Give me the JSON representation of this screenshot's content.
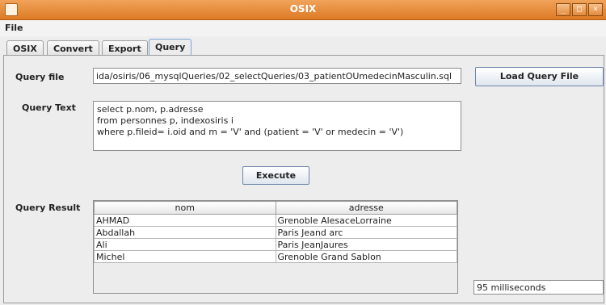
{
  "window": {
    "title": "OSIX",
    "minimize": "_",
    "maximize": "□",
    "close": "×"
  },
  "menu": {
    "file": "File"
  },
  "tabs": [
    {
      "label": "OSIX"
    },
    {
      "label": "Convert"
    },
    {
      "label": "Export"
    },
    {
      "label": "Query"
    }
  ],
  "query_file": {
    "label": "Query file",
    "value": "ida/osiris/06_mysqlQueries/02_selectQueries/03_patientOUmedecinMasculin.sql",
    "load_button": "Load Query File"
  },
  "query_text": {
    "label": "Query Text",
    "lines": [
      "select p.nom, p.adresse",
      "from personnes p, indexosiris i",
      "where p.fileid= i.oid and m = 'V' and (patient = 'V' or medecin = 'V')"
    ]
  },
  "execute_button": "Execute",
  "query_result": {
    "label": "Query Result",
    "columns": [
      "nom",
      "adresse"
    ],
    "rows": [
      [
        "AHMAD",
        "Grenoble AlesaceLorraine"
      ],
      [
        "Abdallah",
        "Paris Jeand arc"
      ],
      [
        "Ali",
        "Paris JeanJaures"
      ],
      [
        "Michel",
        "Grenoble Grand Sablon"
      ]
    ]
  },
  "timing": "95 milliseconds"
}
